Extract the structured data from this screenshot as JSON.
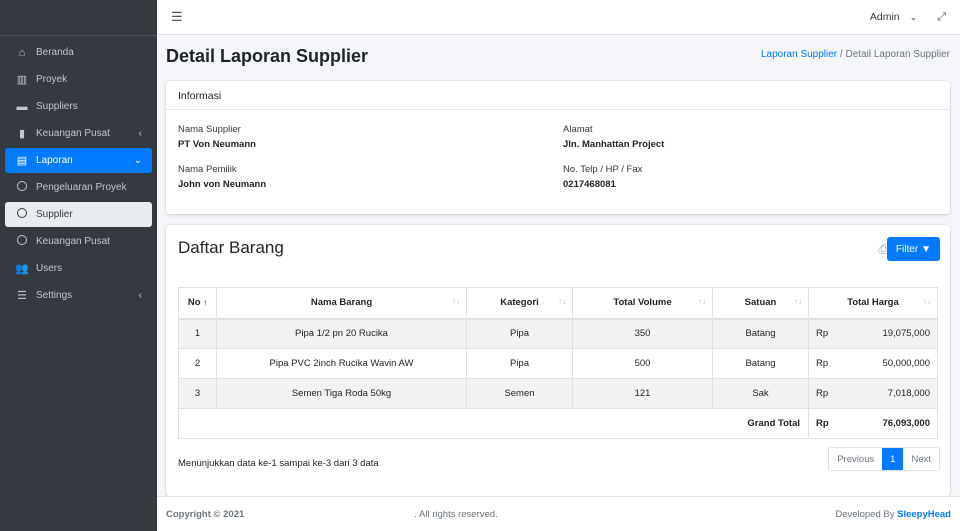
{
  "sidebar": {
    "items": [
      {
        "label": "Beranda",
        "icon": "home-icon",
        "glyph": "⌂"
      },
      {
        "label": "Proyek",
        "icon": "building-icon",
        "glyph": "▥"
      },
      {
        "label": "Suppliers",
        "icon": "store-icon",
        "glyph": "▬"
      },
      {
        "label": "Keuangan Pusat",
        "icon": "ledger-icon",
        "glyph": "▮"
      },
      {
        "label": "Laporan",
        "icon": "file-icon",
        "glyph": "▤"
      },
      {
        "label": "Pengeluaran Proyek"
      },
      {
        "label": "Supplier"
      },
      {
        "label": "Keuangan Pusat"
      },
      {
        "label": "Users",
        "icon": "users-icon",
        "glyph": "👥"
      },
      {
        "label": "Settings",
        "icon": "sliders-icon",
        "glyph": "☰"
      }
    ]
  },
  "topbar": {
    "user": "Admin"
  },
  "page": {
    "title": "Detail Laporan Supplier",
    "breadcrumb": [
      "Laporan Supplier",
      "Detail Laporan Supplier"
    ]
  },
  "info": {
    "header": "Informasi",
    "nama_supplier_label": "Nama Supplier",
    "nama_supplier": "PT Von Neumann",
    "alamat_label": "Alamat",
    "alamat": "Jln. Manhattan Project",
    "pemilik_label": "Nama Pemilik",
    "pemilik": "John von Neumann",
    "telp_label": "No. Telp / HP / Fax",
    "telp": "0217468081"
  },
  "daftar": {
    "title": "Daftar Barang",
    "filter": "Filter",
    "columns": [
      "No",
      "Nama Barang",
      "Kategori",
      "Total Volume",
      "Satuan",
      "Total Harga"
    ],
    "rows": [
      {
        "no": "1",
        "nama": "Pipa 1/2 pn 20 Rucika",
        "kategori": "Pipa",
        "volume": "350",
        "satuan": "Batang",
        "currency": "Rp",
        "harga": "19,075,000"
      },
      {
        "no": "2",
        "nama": "Pipa PVC 2inch Rucika Wavin AW",
        "kategori": "Pipa",
        "volume": "500",
        "satuan": "Batang",
        "currency": "Rp",
        "harga": "50,000,000"
      },
      {
        "no": "3",
        "nama": "Semen Tiga Roda 50kg",
        "kategori": "Semen",
        "volume": "121",
        "satuan": "Sak",
        "currency": "Rp",
        "harga": "7,018,000"
      }
    ],
    "grand_total_label": "Grand Total",
    "grand_total_currency": "Rp",
    "grand_total": "76,093,000",
    "showing": "Menunjukkan data ke-1 sampai ke-3 dari 3 data",
    "pager": {
      "prev": "Previous",
      "page": "1",
      "next": "Next"
    }
  },
  "footer": {
    "copyright": "Copyright © 2021",
    "rights": ". All rights reserved.",
    "dev_prefix": "Developed By ",
    "dev": "SleepyHead"
  }
}
